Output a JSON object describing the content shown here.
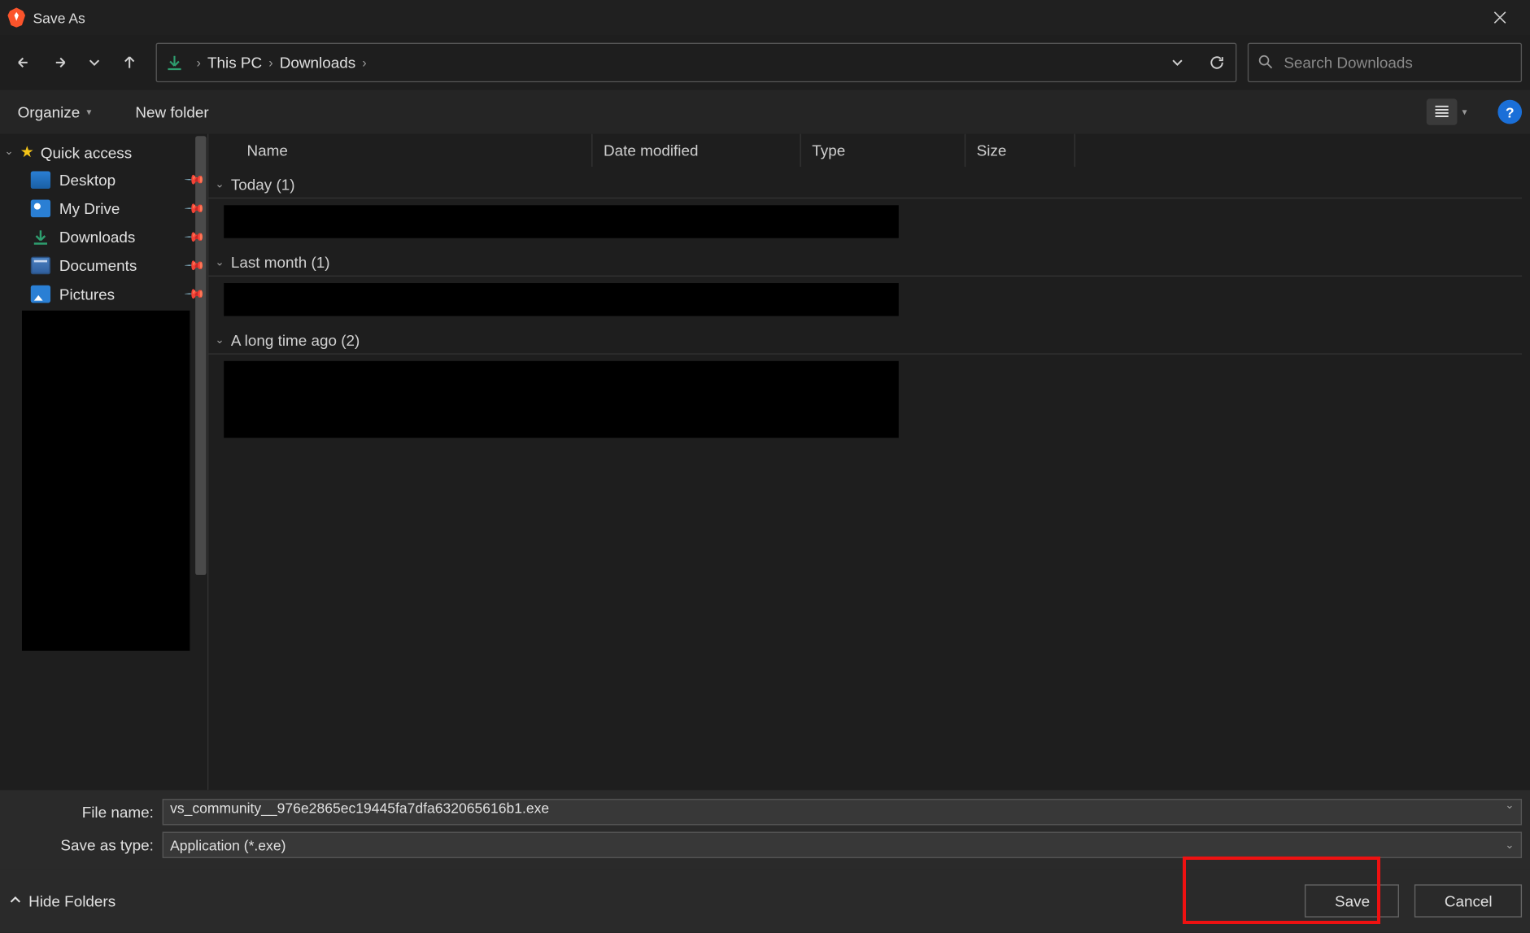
{
  "titlebar": {
    "title": "Save As"
  },
  "nav": {
    "breadcrumb": {
      "pc": "This PC",
      "downloads": "Downloads"
    },
    "search_placeholder": "Search Downloads"
  },
  "toolbar": {
    "organize": "Organize",
    "new_folder": "New folder"
  },
  "sidebar": {
    "quick_access": "Quick access",
    "items": [
      {
        "label": "Desktop",
        "icon": "desktop"
      },
      {
        "label": "My Drive",
        "icon": "drive"
      },
      {
        "label": "Downloads",
        "icon": "downloads"
      },
      {
        "label": "Documents",
        "icon": "folder"
      },
      {
        "label": "Pictures",
        "icon": "pictures"
      }
    ]
  },
  "columns": {
    "name": "Name",
    "date": "Date modified",
    "type": "Type",
    "size": "Size"
  },
  "groups": {
    "today": "Today (1)",
    "last_month": "Last month (1)",
    "long_ago": "A long time ago (2)"
  },
  "form": {
    "file_name_label": "File name:",
    "file_name_value": "vs_community__976e2865ec19445fa7dfa632065616b1.exe",
    "save_type_label": "Save as type:",
    "save_type_value": "Application (*.exe)"
  },
  "footer": {
    "hide_folders": "Hide Folders",
    "save": "Save",
    "cancel": "Cancel"
  }
}
